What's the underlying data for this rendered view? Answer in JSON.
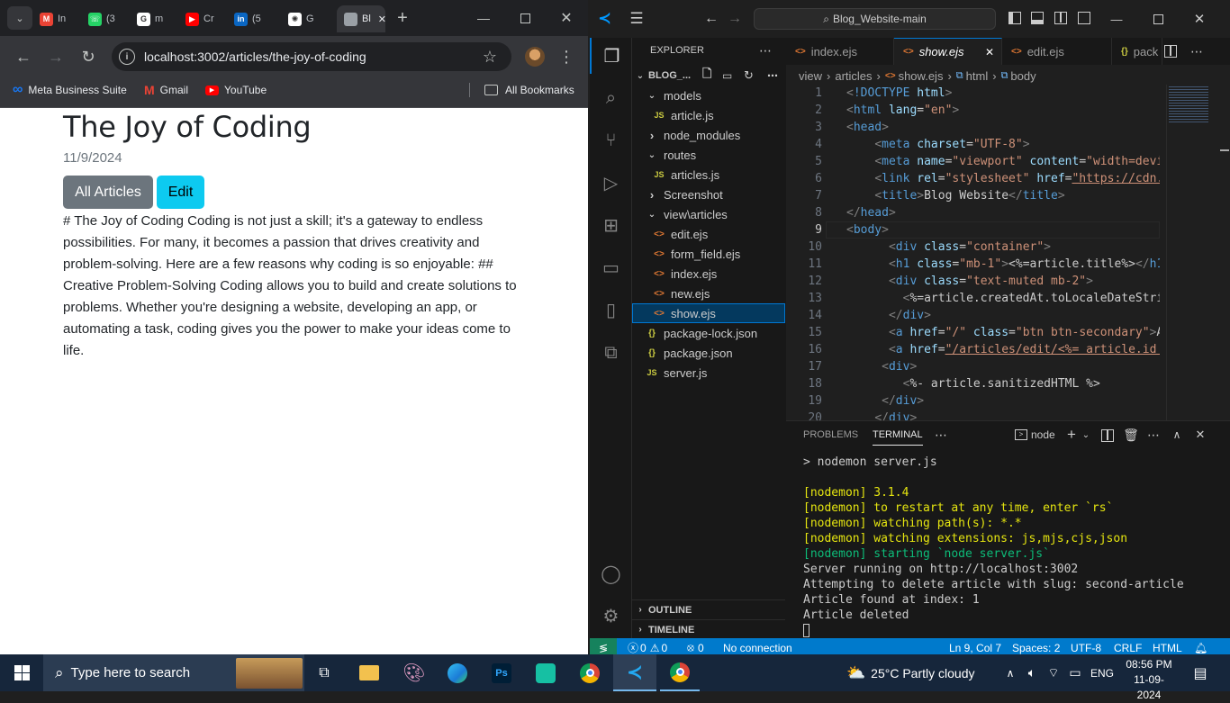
{
  "browser": {
    "tabs": [
      {
        "label": "In",
        "icon": "gmail-icon",
        "color": "#ea4335"
      },
      {
        "label": "(3",
        "icon": "whatsapp-icon",
        "color": "#25d366"
      },
      {
        "label": "m",
        "icon": "google-icon",
        "color": "#ffffff"
      },
      {
        "label": "Cr",
        "icon": "youtube-icon",
        "color": "#ff0000"
      },
      {
        "label": "(5",
        "icon": "linkedin-icon",
        "color": "#0a66c2"
      },
      {
        "label": "G",
        "icon": "chatgpt-icon",
        "color": "#ffffff"
      },
      {
        "label": "Bl",
        "icon": "page-icon",
        "color": "#9aa0a6",
        "active": true
      }
    ],
    "address": "localhost:3002/articles/the-joy-of-coding",
    "bookmarks": [
      "Meta Business Suite",
      "Gmail",
      "YouTube"
    ],
    "all_bookmarks": "All Bookmarks"
  },
  "article": {
    "title": "The Joy of Coding",
    "date": "11/9/2024",
    "btn_all": "All Articles",
    "btn_edit": "Edit",
    "body": "# The Joy of Coding Coding is not just a skill; it's a gateway to endless possibilities. For many, it becomes a passion that drives creativity and problem-solving. Here are a few reasons why coding is so enjoyable: ## Creative Problem-Solving Coding allows you to build and create solutions to problems. Whether you're designing a website, developing an app, or automating a task, coding gives you the power to make your ideas come to life."
  },
  "vscode": {
    "search": "Blog_Website-main",
    "explorer_title": "EXPLORER",
    "root": "BLOG_...",
    "tree": [
      {
        "label": "models",
        "type": "folder-open",
        "indent": 1
      },
      {
        "label": "article.js",
        "type": "js",
        "indent": 2
      },
      {
        "label": "node_modules",
        "type": "folder",
        "indent": 1
      },
      {
        "label": "routes",
        "type": "folder-open",
        "indent": 1
      },
      {
        "label": "articles.js",
        "type": "js",
        "indent": 2
      },
      {
        "label": "Screenshot",
        "type": "folder",
        "indent": 1
      },
      {
        "label": "view\\articles",
        "type": "folder-open",
        "indent": 1
      },
      {
        "label": "edit.ejs",
        "type": "ejs",
        "indent": 2
      },
      {
        "label": "form_field.ejs",
        "type": "ejs",
        "indent": 2
      },
      {
        "label": "index.ejs",
        "type": "ejs",
        "indent": 2
      },
      {
        "label": "new.ejs",
        "type": "ejs",
        "indent": 2
      },
      {
        "label": "show.ejs",
        "type": "ejs",
        "indent": 2,
        "selected": true
      },
      {
        "label": "package-lock.json",
        "type": "json",
        "indent": 1
      },
      {
        "label": "package.json",
        "type": "json",
        "indent": 1
      },
      {
        "label": "server.js",
        "type": "js",
        "indent": 1
      }
    ],
    "outline": "OUTLINE",
    "timeline": "TIMELINE",
    "tabs": [
      {
        "label": "index.ejs"
      },
      {
        "label": "show.ejs",
        "active": true
      },
      {
        "label": "edit.ejs"
      },
      {
        "label": "pack"
      }
    ],
    "breadcrumb": [
      "view",
      "articles",
      "show.ejs",
      "html",
      "body"
    ],
    "line_numbers": [
      "1",
      "2",
      "3",
      "4",
      "5",
      "6",
      "7",
      "8",
      "9",
      "10",
      "11",
      "12",
      "13",
      "14",
      "15",
      "16",
      "17",
      "18",
      "19",
      "20"
    ],
    "panel_tabs": [
      "PROBLEMS",
      "TERMINAL"
    ],
    "terminal_shell": "node",
    "terminal": [
      {
        "text": "> nodemon server.js",
        "color": "#cccccc"
      },
      {
        "text": "",
        "color": "#cccccc"
      },
      {
        "text": "[nodemon] 3.1.4",
        "color": "#e5e510"
      },
      {
        "text": "[nodemon] to restart at any time, enter `rs`",
        "color": "#e5e510"
      },
      {
        "text": "[nodemon] watching path(s): *.*",
        "color": "#e5e510"
      },
      {
        "text": "[nodemon] watching extensions: js,mjs,cjs,json",
        "color": "#e5e510"
      },
      {
        "text": "[nodemon] starting `node server.js`",
        "color": "#0dbc79"
      },
      {
        "text": "Server running on http://localhost:3002",
        "color": "#cccccc"
      },
      {
        "text": "Attempting to delete article with slug: second-article",
        "color": "#cccccc"
      },
      {
        "text": "Article found at index: 1",
        "color": "#cccccc"
      },
      {
        "text": "Article deleted",
        "color": "#cccccc"
      }
    ],
    "status": {
      "errors": "0",
      "warnings": "0",
      "ports": "0",
      "connection": "No connection",
      "position": "Ln 9, Col 7",
      "spaces": "Spaces: 2",
      "encoding": "UTF-8",
      "eol": "CRLF",
      "language": "HTML"
    }
  },
  "taskbar": {
    "search_placeholder": "Type here to search",
    "weather": "25°C  Partly cloudy",
    "lang": "ENG",
    "time": "08:56 PM",
    "date": "11-09-2024"
  },
  "colors": {
    "vscode_accent": "#007acc",
    "btn_secondary": "#6c757d",
    "btn_info": "#0dcaf0",
    "taskbar": "#16263b"
  }
}
